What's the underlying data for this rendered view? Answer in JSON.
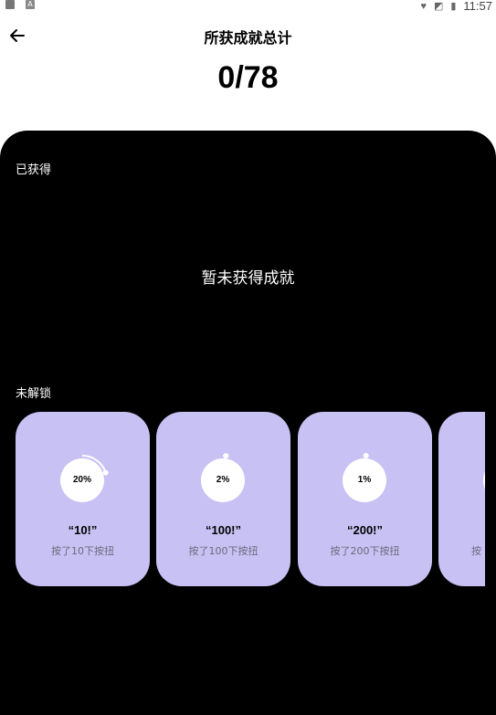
{
  "status_bar": {
    "time": "11:57"
  },
  "header": {
    "title": "所获成就总计"
  },
  "summary": {
    "total": "0/78"
  },
  "earned": {
    "label": "已获得",
    "empty_text": "暂未获得成就"
  },
  "locked": {
    "label": "未解锁",
    "cards": [
      {
        "percent_text": "20%",
        "progress": 0.2,
        "title": "“10!”",
        "desc": "按了10下按扭"
      },
      {
        "percent_text": "2%",
        "progress": 0.02,
        "title": "“100!”",
        "desc": "按了100下按扭"
      },
      {
        "percent_text": "1%",
        "progress": 0.01,
        "title": "“200!”",
        "desc": "按了200下按扭"
      },
      {
        "percent_text": "",
        "progress": 0.0,
        "title": "",
        "desc": "按"
      }
    ]
  },
  "colors": {
    "card_bg": "#c8c1f4",
    "panel_bg": "#000000"
  }
}
